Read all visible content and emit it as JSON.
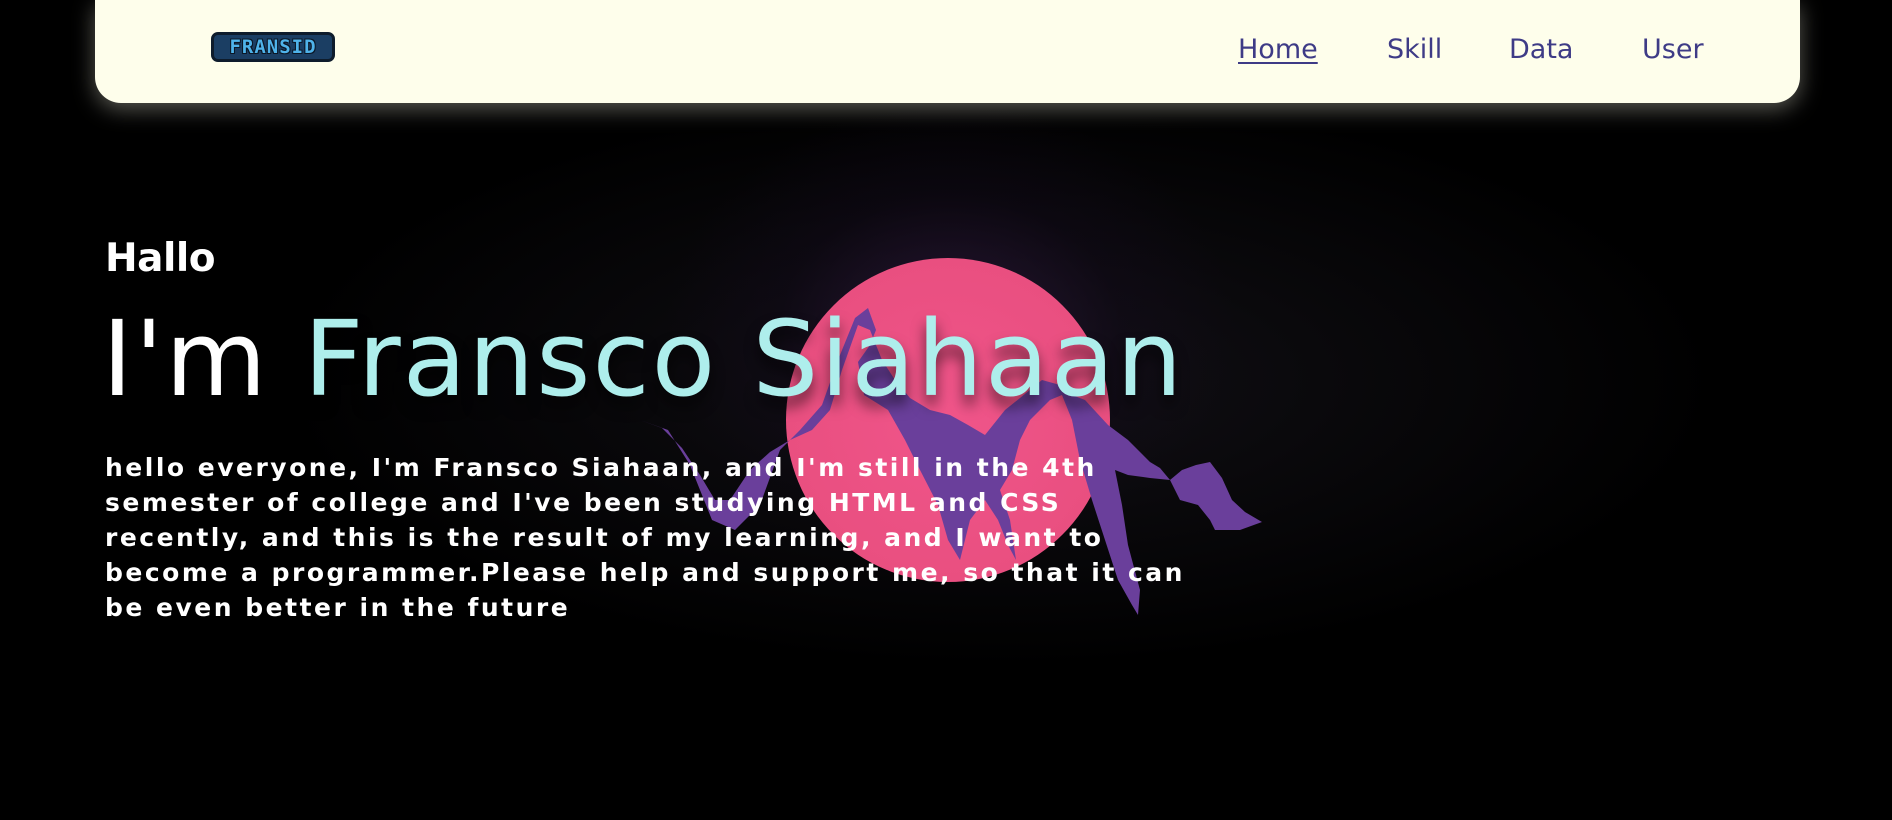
{
  "navbar": {
    "logo_text": "FRANSID",
    "links": [
      {
        "label": "Home",
        "active": true
      },
      {
        "label": "Skill",
        "active": false
      },
      {
        "label": "Data",
        "active": false
      },
      {
        "label": "User",
        "active": false
      }
    ]
  },
  "hero": {
    "greeting": "Hallo",
    "headline_prefix": "I'm",
    "headline_name": "Fransco Siahaan",
    "intro": "hello everyone, I'm Fransco Siahaan, and I'm still in the 4th semester of college and I've been studying HTML and CSS recently, and this is the result of my learning, and I want to become a programmer.Please help and support me, so that it can be even better in the future"
  },
  "colors": {
    "background": "#000000",
    "navbar_bg": "#fefeeb",
    "nav_link": "#3e3b86",
    "name_accent": "#aeeeec",
    "sun": "#ef5384",
    "mountain": "#6a3f9b"
  }
}
